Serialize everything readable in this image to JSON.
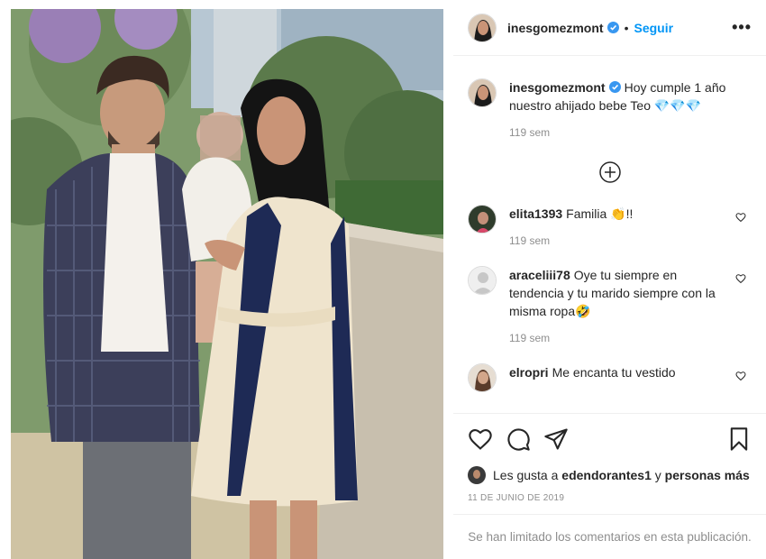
{
  "post": {
    "author": "inesgomezmont",
    "follow_label": "Seguir",
    "separator": "•",
    "more_label": "•••",
    "caption": "Hoy cumple 1 año nuestro ahijado bebe Teo 💎💎💎",
    "caption_age": "119 sem"
  },
  "comments": [
    {
      "user": "elita1393",
      "text": "Familia 👏!!",
      "age": "119 sem"
    },
    {
      "user": "araceliii78",
      "text": "Oye tu siempre en tendencia y tu marido siempre con la misma ropa🤣",
      "age": "119 sem"
    },
    {
      "user": "elropri",
      "text": "Me encanta tu vestido",
      "age": ""
    }
  ],
  "likes": {
    "prefix": "Les gusta a",
    "user": "edendorantes1",
    "conjunction": "y",
    "others": "personas más"
  },
  "date": "11 DE JUNIO DE 2019",
  "comments_limited": "Se han limitado los comentarios en esta publicación.",
  "icons": {
    "verified": "verified-badge-icon",
    "like": "heart-icon",
    "comment": "comment-bubble-icon",
    "share": "paper-plane-icon",
    "save": "bookmark-icon",
    "load_more": "plus-circle-icon"
  },
  "colors": {
    "accent": "#0095f6",
    "muted": "#8e8e8e",
    "text": "#262626",
    "border": "#efefef"
  }
}
